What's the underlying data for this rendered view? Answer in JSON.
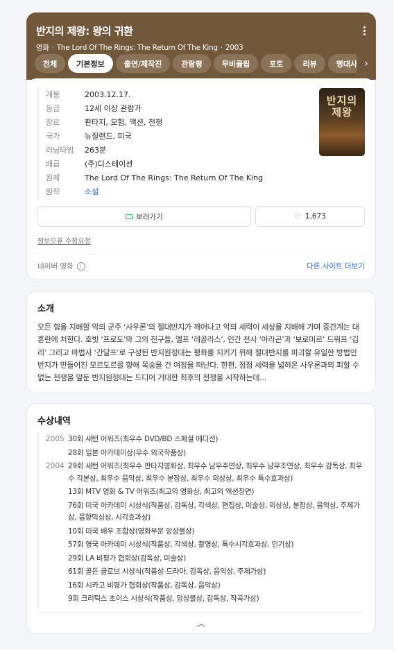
{
  "hero": {
    "title": "반지의 제왕: 왕의 귀환",
    "category": "영화",
    "original_title": "The Lord Of The Rings: The Return Of The King",
    "year": "2003",
    "bg_color": "#72583b"
  },
  "tabs": [
    {
      "label": "전체",
      "active": false
    },
    {
      "label": "기본정보",
      "active": true
    },
    {
      "label": "출연/제작진",
      "active": false
    },
    {
      "label": "관람평",
      "active": false
    },
    {
      "label": "무비클립",
      "active": false
    },
    {
      "label": "포토",
      "active": false
    },
    {
      "label": "리뷰",
      "active": false
    },
    {
      "label": "명대사",
      "active": false
    }
  ],
  "facts": [
    {
      "k": "개봉",
      "v": "2003.12.17."
    },
    {
      "k": "등급",
      "v": "12세 이상 관람가"
    },
    {
      "k": "장르",
      "v": "판타지, 모험, 액션, 전쟁"
    },
    {
      "k": "국가",
      "v": "뉴질랜드, 미국"
    },
    {
      "k": "러닝타임",
      "v": "263분"
    },
    {
      "k": "배급",
      "v": "(주)디스테이션"
    },
    {
      "k": "원제",
      "v": "The Lord Of The Rings: The Return Of The King"
    },
    {
      "k": "원작",
      "v": "소설"
    }
  ],
  "poster": {
    "title": "반지의\n제왕"
  },
  "buttons": {
    "watch": "보러가기",
    "likes": "1,673"
  },
  "report_link": "정보오류 수정요청",
  "source": {
    "label": "네이버 영화",
    "more_sites": "다른 사이트 더보기"
  },
  "synopsis": {
    "heading": "소개",
    "text": "모든 힘을 지배할 악의 군주 ‘사우론’의 절대반지가 깨어나고 악의 세력이 세상을 지배해 가며 중간계는 대혼란에 처한다. 호빗 ‘프로도’와 그의 친구들, 엘프 ‘레골라스’, 인간 전사 ‘아라곤’과 ‘보로미르’ 드워프 ‘김리’ 그리고 마법사 ‘간달프’로 구성된 반지원정대는 평화를 지키기 위해 절대반지를 파괴할 유일한 방법인 반지가 만들어진 모르도르를 향해 목숨을 건 여정을 떠난다. 한편, 점점 세력을 넓혀온 사우론과의 피할 수 없는 전쟁을 앞둔 반지원정대는 드디어 거대한 최후의 전쟁을 시작하는데..."
  },
  "awards": {
    "heading": "수상내역",
    "years": [
      {
        "year": "2005",
        "items": [
          "30회 새턴 어워즈(최우수 DVD/BD 스페셜 에디션)",
          "28회 일본 아카데미상(우수 외국작품상)"
        ]
      },
      {
        "year": "2004",
        "items": [
          "29회 새턴 어워즈(최우수 판타지영화상, 최우수 남우주연상, 최우수 남우조연상, 최우수 감독상, 최우수 각본상, 최우수 음악상, 최우수 분장상, 최우수 의상상, 최우수 특수효과상)",
          "13회 MTV 영화 & TV 어워즈(최고의 영화상, 최고의 액션장면)",
          "76회 미국 아카데미 시상식(작품상, 감독상, 각색상, 편집상, 미술상, 의상상, 분장상, 음악상, 주제가상, 음향믹싱상, 시각효과상)",
          "10회 미국 배우 조합상(영화부문 앙상블상)",
          "57회 영국 아카데미 시상식(작품상, 각색상, 촬영상, 특수시각효과상, 인기상)",
          "29회 LA 비평가 협회상(감독상, 미술상)",
          "61회 골든 글로브 시상식(작품상-드라마, 감독상, 음악상, 주제가상)",
          "16회 시카고 비평가 협회상(작품상, 감독상, 음악상)",
          "9회 크리틱스 초이스 시상식(작품상, 앙상블상, 감독상, 작곡가상)"
        ]
      }
    ]
  }
}
